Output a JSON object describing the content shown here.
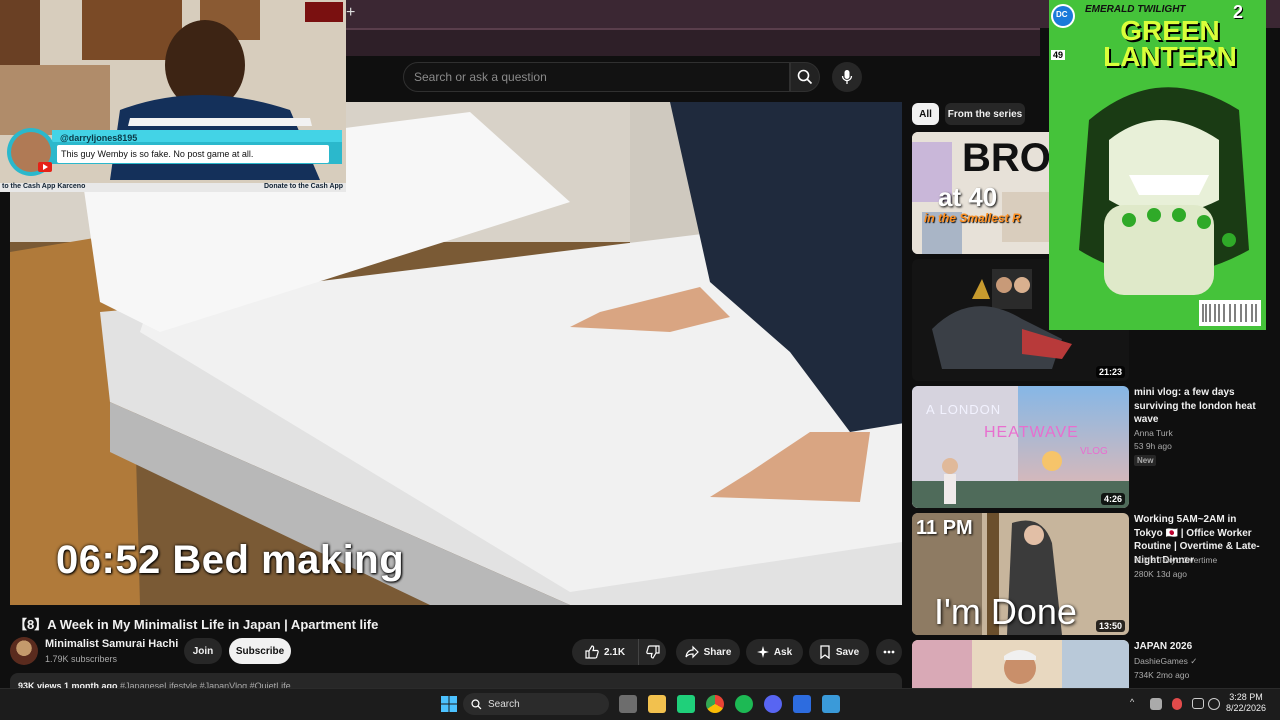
{
  "browser": {
    "new_tab_glyph": "+"
  },
  "search": {
    "placeholder": "Search or ask a question",
    "icon": "search-icon",
    "mic_icon": "mic-icon"
  },
  "video": {
    "caption": "06:52 Bed making",
    "title": "【8】A Week in My Minimalist Life in Japan | Apartment life"
  },
  "channel": {
    "name": "Minimalist Samurai Hachi",
    "subscribers": "1.79K subscribers",
    "join_label": "Join",
    "subscribe_label": "Subscribe"
  },
  "actions": {
    "likes": "2.1K",
    "share": "Share",
    "ask": "Ask",
    "save": "Save"
  },
  "description": {
    "stats": "93K views  1 month ago",
    "tags": "#JapaneseLifestyle #JapanVlog #QuietLife"
  },
  "chips": {
    "all": "All",
    "series": "From the series"
  },
  "recommendations": [
    {
      "thumb_text_1": "BRO",
      "thumb_text_2": "at 40",
      "thumb_text_3": "in the Smallest R"
    },
    {
      "duration": "21:23"
    },
    {
      "title": "mini vlog: a few days surviving the london heat wave",
      "channel": "Anna Turk",
      "meta": "53  9h ago",
      "badge": "New",
      "duration": "4:26",
      "thumb_text_1": "A LONDON",
      "thumb_text_2": "HEATWAVE",
      "thumb_text_3": "VLOG"
    },
    {
      "title": "Working 5AM~2AM in Tokyo 🇯🇵 | Office Worker Routine | Overtime & Late-Night Dinner",
      "channel": "Yuki's Tokyo Overtime",
      "meta": "280K  13d ago",
      "duration": "13:50",
      "thumb_text_1": "11 PM",
      "thumb_text_2": "I'm Done"
    },
    {
      "title": "JAPAN 2026",
      "channel": "DashieGames ✓",
      "meta": "734K  2mo ago"
    }
  ],
  "webcam": {
    "chat_user": "@darryljones8195",
    "chat_message": "This guy Wemby is so fake. No post game at all.",
    "ticker_left": "to the Cash App Karceno",
    "ticker_right": "Donate to the Cash App"
  },
  "comic": {
    "top_line": "EMERALD TWILIGHT",
    "part": "2",
    "title": "GREEN LANTERN",
    "issue": "49",
    "logo": "DC"
  },
  "taskbar": {
    "search_label": "Search",
    "time": "3:28 PM",
    "date": "8/22/2026"
  }
}
